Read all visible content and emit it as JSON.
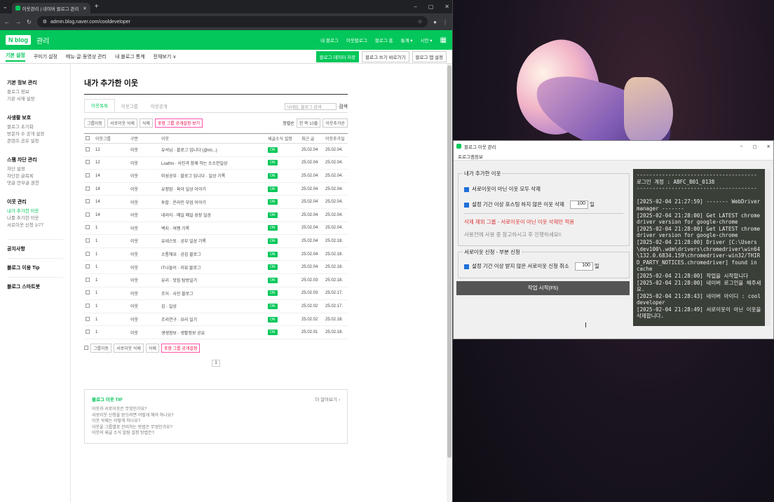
{
  "browser": {
    "tab_title": "이웃관리 | 네이버 블로그 관리",
    "url": "admin.blog.naver.com/cooldeveloper"
  },
  "header": {
    "logo": "N blog",
    "title": "관리",
    "nav": [
      "내 블로그",
      "이웃블로그",
      "블로그 홈",
      "통계 ▾",
      "시안 ▾"
    ]
  },
  "subnav": {
    "items": [
      "기본 설정",
      "꾸미기 설정",
      "메뉴·글·동영상 관리",
      "내 블로그 통계",
      "전체보기 ∨"
    ],
    "buttons": [
      "블로그 데이터 저장",
      "블로그 쓰기 바로가기",
      "블로그 앱 설정"
    ]
  },
  "sidebar": {
    "groups": [
      {
        "title": "기본 정보 관리",
        "items": [
          "블로그 정보",
          "기본 서재 설정"
        ]
      },
      {
        "title": "사생활 보호",
        "items": [
          "블로그 초기화",
          "방문자 수 공개 설정",
          "콘텐츠 공유 설정"
        ]
      },
      {
        "title": "스팸 차단 관리",
        "items": [
          "차단 설정",
          "차단된 글목록",
          "댓글·안부글 권한"
        ]
      },
      {
        "title": "이웃 관리",
        "items": [
          "내가 추가한 이웃",
          "나를 추가한 이웃",
          "서로이웃 신청 1/77"
        ]
      }
    ],
    "links": [
      "공지사항",
      "블로그 이용 Tip",
      "블로그 스마트봇"
    ]
  },
  "main": {
    "title": "내가 추가한 이웃",
    "tabs": [
      "이웃목록",
      "이웃그룹",
      "이웃공개"
    ],
    "search_placeholder": "닉네임, 블로그 검색",
    "search_btn": "검색",
    "actions": [
      "그룹이동",
      "서로이웃 삭제",
      "삭제",
      "포함 그룹 공개설정 보기"
    ],
    "sort1": "정렬순",
    "sort2": "한 쪽 10줄",
    "sort3": "이웃추가순",
    "columns": [
      "",
      "이웃그룹",
      "구분",
      "이웃",
      "새글소식 설정",
      "최근 글",
      "이웃추가일"
    ],
    "rows": [
      {
        "grp": "12",
        "kind": "이웃",
        "name": "유석님 · 블로그 입니다 (@mi...)",
        "badge": "ON",
        "last": "25.02.04",
        "added": "25.02.04."
      },
      {
        "grp": "12",
        "kind": "이웃",
        "name": "Loafmi · 사진과 함께 하는 소소한일상",
        "badge": "ON",
        "last": "25.02.04",
        "added": "25.02.04."
      },
      {
        "grp": "14",
        "kind": "이웃",
        "name": "미성공부 · 블로그 입니다 · 일상 기록",
        "badge": "ON",
        "last": "25.02.04",
        "added": "25.02.04."
      },
      {
        "grp": "14",
        "kind": "이웃",
        "name": "유정맘 · 육아 일상 이야기",
        "badge": "ON",
        "last": "25.02.04",
        "added": "25.02.04."
      },
      {
        "grp": "14",
        "kind": "이웃",
        "name": "투잡 · 온라인 부업 이야기",
        "badge": "ON",
        "last": "25.02.04",
        "added": "25.02.04."
      },
      {
        "grp": "14",
        "kind": "이웃",
        "name": "네리아 · 매일 매일 성장 일상",
        "badge": "ON",
        "last": "25.02.04",
        "added": "25.02.04."
      },
      {
        "grp": "1",
        "kind": "이웃",
        "name": "백지 · 여행 기록",
        "badge": "ON",
        "last": "25.02.04",
        "added": "25.02.04."
      },
      {
        "grp": "1",
        "kind": "이웃",
        "name": "유네스토 · 공부 일상 기록",
        "badge": "ON",
        "last": "25.02.04",
        "added": "25.02.18."
      },
      {
        "grp": "1",
        "kind": "이웃",
        "name": "소통해요 · 공감 블로그",
        "badge": "ON",
        "last": "25.02.04",
        "added": "25.02.18."
      },
      {
        "grp": "1",
        "kind": "이웃",
        "name": "IT나들이 · 리뷰 블로그",
        "badge": "ON",
        "last": "25.02.04",
        "added": "25.02.18."
      },
      {
        "grp": "1",
        "kind": "이웃",
        "name": "유리 · 맛집 탐방일기",
        "badge": "ON",
        "last": "25.02.03",
        "added": "25.02.18."
      },
      {
        "grp": "1",
        "kind": "이웃",
        "name": "조이 · 사진 블로그",
        "badge": "ON",
        "last": "25.02.03",
        "added": "25.02.17."
      },
      {
        "grp": "1",
        "kind": "이웃",
        "name": "김 · 일상",
        "badge": "ON",
        "last": "25.02.02",
        "added": "25.02.17."
      },
      {
        "grp": "1",
        "kind": "이웃",
        "name": "조리연구 · 요리 일기",
        "badge": "ON",
        "last": "25.02.02",
        "added": "25.02.18."
      },
      {
        "grp": "1",
        "kind": "이웃",
        "name": "생생정보 · 생활정보 공유",
        "badge": "ON",
        "last": "25.02.01",
        "added": "25.02.18."
      }
    ],
    "bottom": [
      "그룹이동",
      "서로이웃 삭제",
      "삭제",
      "포함 그룹 공개설정"
    ],
    "page": "1",
    "tip_title": "블로그 이웃 TIP",
    "tip_more": "더 알아보기 ›",
    "tips": [
      "이웃과 서로이웃은 무엇인가요?",
      "서로이웃 신청을 받으려면 어떻게 해야 하나요?",
      "이웃 삭제는 어떻게 하나요?",
      "이웃을 그룹별로 관리하는 방법은 무엇인가요?",
      "이웃의 새글 소식 알림 설정 방법은?"
    ]
  },
  "app": {
    "title": "블로그 이웃 관리",
    "menu": "프로그램정보",
    "grp1_title": "내가 추가한 이웃",
    "opt1": "서로이웃이 아닌 이웃 모두 삭제",
    "opt2": "설정 기간 이상 포스팅 하지 않은 이웃 삭제",
    "opt2_val": "100",
    "opt2_unit": "일",
    "warn": "삭제 제외 그룹 - 서로이웃이 아닌 이웃 삭제만 적용",
    "hint": "사용전에 사용 중 참고하시고 후 진행하세요!!",
    "grp2_title": "서로이웃 신청 - 부분 신청",
    "opt3": "설정 기간 이상 받지 않은 서로이웃 신청 취소",
    "opt3_val": "100",
    "opt3_unit": "일",
    "run": "작업 시작(F5)",
    "log": [
      "--------------------------------------",
      "로그인 계정 : ABFC_B01_0138",
      "--------------------------------------",
      "",
      "[2025-02-04 21:27:59] ------- WebDriver manager -------",
      "[2025-02-04 21:28:00] Get LATEST chromedriver version for google-chrome",
      "[2025-02-04 21:28:00] Get LATEST chromedriver version for google-chrome",
      "[2025-02-04 21:28:00] Driver [C:\\Users\\dev100\\.wdm\\drivers\\chromedriver\\win64\\132.0.6834.159\\chromedriver-win32/THIRD_PARTY_NOTICES.chromedriver] found in cache",
      "[2025-02-04 21:28:00] 작업을 시작합니다",
      "[2025-02-04 21:28:00] 네이버 로그인을 해주세요.",
      "[2025-02-04 21:28:43] 네이버 아이디 : cooldeveloper",
      "[2025-02-04 21:28:49] 서로이웃이 아닌 이웃을 삭제합니다."
    ]
  }
}
